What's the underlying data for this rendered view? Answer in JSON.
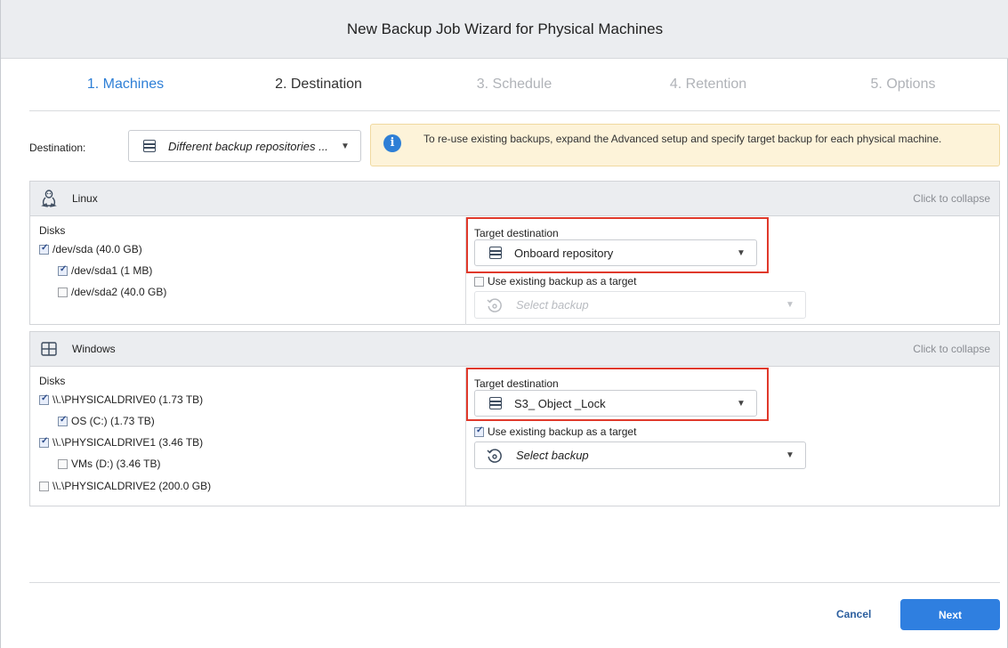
{
  "window": {
    "title": "New Backup Job Wizard for Physical Machines"
  },
  "steps": [
    {
      "label": "1. Machines",
      "state": "done"
    },
    {
      "label": "2. Destination",
      "state": "current"
    },
    {
      "label": "3. Schedule",
      "state": "pending"
    },
    {
      "label": "4. Retention",
      "state": "pending"
    },
    {
      "label": "5. Options",
      "state": "pending"
    }
  ],
  "destination": {
    "label": "Destination:",
    "value": "Different backup repositories ...",
    "icon": "repository-icon"
  },
  "info": {
    "icon": "info-icon",
    "text": "To re-use existing backups, expand the Advanced setup and specify target backup for each physical machine."
  },
  "linux": {
    "name": "Linux",
    "icon": "linux-icon",
    "collapse_label": "Click to collapse",
    "disks_title": "Disks",
    "disks": [
      {
        "label": "/dev/sda (40.0 GB)",
        "checked": true,
        "level": 0
      },
      {
        "label": "/dev/sda1 (1 MB)",
        "checked": true,
        "level": 1
      },
      {
        "label": "/dev/sda2 (40.0 GB)",
        "checked": false,
        "level": 1
      }
    ],
    "target_label": "Target destination",
    "target_value": "Onboard repository",
    "use_existing_label": "Use existing backup as a target",
    "use_existing_checked": false,
    "select_backup_placeholder": "Select backup",
    "select_backup_enabled": false
  },
  "windows": {
    "name": "Windows",
    "icon": "windows-icon",
    "collapse_label": "Click to collapse",
    "disks_title": "Disks",
    "disks": [
      {
        "label": "\\\\.\\PHYSICALDRIVE0 (1.73 TB)",
        "checked": true,
        "level": 0
      },
      {
        "label": "OS (C:) (1.73 TB)",
        "checked": true,
        "level": 1
      },
      {
        "label": "\\\\.\\PHYSICALDRIVE1 (3.46 TB)",
        "checked": true,
        "level": 0
      },
      {
        "label": "VMs (D:) (3.46 TB)",
        "checked": false,
        "level": 1
      },
      {
        "label": "\\\\.\\PHYSICALDRIVE2 (200.0 GB)",
        "checked": false,
        "level": 0
      }
    ],
    "target_label": "Target destination",
    "target_value": "S3_ Object _Lock",
    "use_existing_label": "Use existing backup as a target",
    "use_existing_checked": true,
    "select_backup_placeholder": "Select backup",
    "select_backup_enabled": true
  },
  "footer": {
    "cancel_label": "Cancel",
    "next_label": "Next"
  },
  "colors": {
    "accent": "#2f7fe0",
    "highlight": "#e0392b",
    "info_bg": "#fdf3d9"
  }
}
